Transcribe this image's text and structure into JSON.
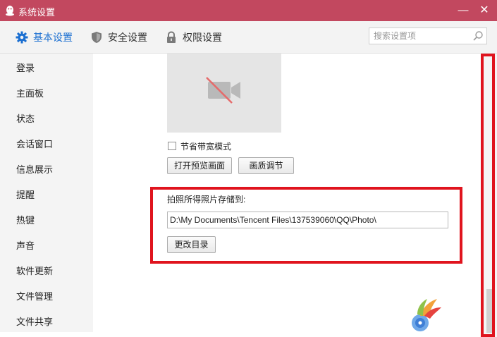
{
  "window": {
    "title": "系统设置",
    "minimize": "—",
    "close": "✕"
  },
  "tabs": [
    {
      "label": "基本设置",
      "icon": "gear-icon",
      "active": true
    },
    {
      "label": "安全设置",
      "icon": "shield-icon",
      "active": false
    },
    {
      "label": "权限设置",
      "icon": "lock-icon",
      "active": false
    }
  ],
  "search": {
    "placeholder": "搜索设置项"
  },
  "sidebar": {
    "items": [
      {
        "label": "登录"
      },
      {
        "label": "主面板"
      },
      {
        "label": "状态"
      },
      {
        "label": "会话窗口"
      },
      {
        "label": "信息展示"
      },
      {
        "label": "提醒"
      },
      {
        "label": "热键"
      },
      {
        "label": "声音"
      },
      {
        "label": "软件更新"
      },
      {
        "label": "文件管理"
      },
      {
        "label": "文件共享"
      }
    ]
  },
  "main": {
    "preview_icon": "camera-off-icon",
    "bandwidth_save": {
      "label": "节省带宽模式",
      "checked": false
    },
    "open_preview_button": "打开预览画面",
    "quality_button": "画质调节",
    "photo_save": {
      "label": "拍照所得照片存储到:",
      "path": "D:\\My Documents\\Tencent Files\\137539060\\QQ\\Photo\\",
      "change_button": "更改目录"
    }
  },
  "colors": {
    "titlebar": "#c2485f",
    "accent": "#1b6fd1",
    "highlight": "#e0141e"
  }
}
